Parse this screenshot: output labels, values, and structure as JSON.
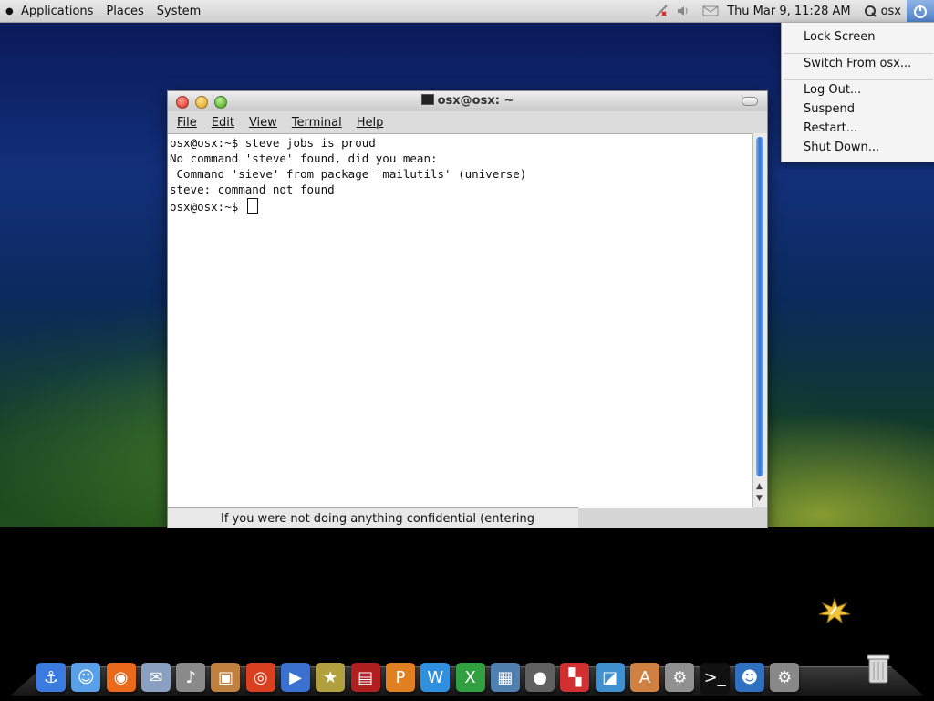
{
  "top_panel": {
    "menus": [
      "Applications",
      "Places",
      "System"
    ],
    "clock": "Thu Mar  9, 11:28 AM",
    "user": "osx",
    "tray_icons": [
      "network-disconnected-icon",
      "volume-icon",
      "mail-icon"
    ]
  },
  "system_menu": {
    "items": [
      "Lock Screen",
      "Switch From osx...",
      "Log Out...",
      "Suspend",
      "Restart...",
      "Shut Down..."
    ]
  },
  "terminal": {
    "title": "osx@osx: ~",
    "menus": [
      "File",
      "Edit",
      "View",
      "Terminal",
      "Help"
    ],
    "lines": [
      "osx@osx:~$ steve jobs is proud",
      "No command 'steve' found, did you mean:",
      " Command 'sieve' from package 'mailutils' (universe)",
      "steve: command not found",
      "osx@osx:~$ "
    ],
    "notice": "If you were not doing anything confidential (entering"
  },
  "dock": {
    "items": [
      {
        "name": "anchor-icon",
        "color": "#3b7be0"
      },
      {
        "name": "finder-icon",
        "color": "#5aa0e8"
      },
      {
        "name": "firefox-icon",
        "color": "#e86a1a"
      },
      {
        "name": "mail-stamp-icon",
        "color": "#8aa0c0"
      },
      {
        "name": "microphone-icon",
        "color": "#8a8a8a"
      },
      {
        "name": "photo-camera-icon",
        "color": "#c08040"
      },
      {
        "name": "burn-disc-icon",
        "color": "#d84020"
      },
      {
        "name": "movie-clapper-icon",
        "color": "#3a70d0"
      },
      {
        "name": "star-movie-icon",
        "color": "#b0a040"
      },
      {
        "name": "film-strip-icon",
        "color": "#b02020"
      },
      {
        "name": "pages-icon",
        "color": "#e08020"
      },
      {
        "name": "word-w-icon",
        "color": "#3090e0"
      },
      {
        "name": "excel-x-icon",
        "color": "#30a040"
      },
      {
        "name": "window-manager-icon",
        "color": "#5080b0"
      },
      {
        "name": "speaker-icon",
        "color": "#606060"
      },
      {
        "name": "blocks-icon",
        "color": "#d03030"
      },
      {
        "name": "disk-utility-icon",
        "color": "#4090d0"
      },
      {
        "name": "font-book-icon",
        "color": "#d08040"
      },
      {
        "name": "system-tool-icon",
        "color": "#909090"
      },
      {
        "name": "terminal-icon",
        "color": "#111111"
      },
      {
        "name": "users-icon",
        "color": "#3070c0"
      },
      {
        "name": "system-preferences-icon",
        "color": "#888888"
      }
    ],
    "trash": "trash-icon"
  }
}
